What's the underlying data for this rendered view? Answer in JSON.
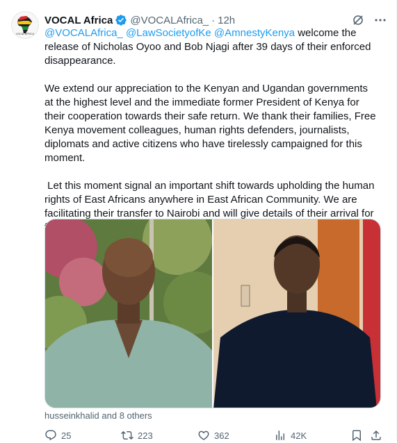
{
  "tweet": {
    "author_name": "VOCAL Africa",
    "author_handle": "@VOCALAfrica_",
    "separator": "·",
    "time": "12h",
    "avatar_logo_text": "VOCAL AFRICA",
    "mentions": [
      "@VOCALAfrica_",
      "@LawSocietyofKe",
      "@AmnestyKenya"
    ],
    "paragraph1_rest": " welcome the release of Nicholas Oyoo and Bob Njagi after 39 days of their enforced disappearance.",
    "paragraph2": "We extend our appreciation to the Kenyan and Ugandan governments at the highest level and the immediate former President of Kenya for their cooperation towards their safe return. We thank their families, Free Kenya movement colleagues, human rights defenders, journalists, diplomats and active citizens who have tirelessly campaigned for this moment.",
    "paragraph3": " Let this moment signal an important shift towards upholding the human rights of East Africans anywhere in East African Community. We are facilitating their transfer to Nairobi and will give details of their arrival for family, friends and comrades to meet them.",
    "tagged": "husseinkhalid and 8 others"
  },
  "actions": {
    "replies": "25",
    "reposts": "223",
    "likes": "362",
    "views": "42K"
  },
  "colors": {
    "accent": "#1d9bf0",
    "text": "#0f1419",
    "muted": "#536471",
    "verified": "#1d9bf0",
    "repost_icon": "#00ba7c"
  },
  "icons": {
    "verified": "verified-badge-icon",
    "grok": "grok-icon",
    "more": "more-icon",
    "reply": "reply-icon",
    "repost": "repost-icon",
    "like": "like-icon",
    "views": "views-icon",
    "bookmark": "bookmark-icon",
    "share": "share-icon"
  }
}
